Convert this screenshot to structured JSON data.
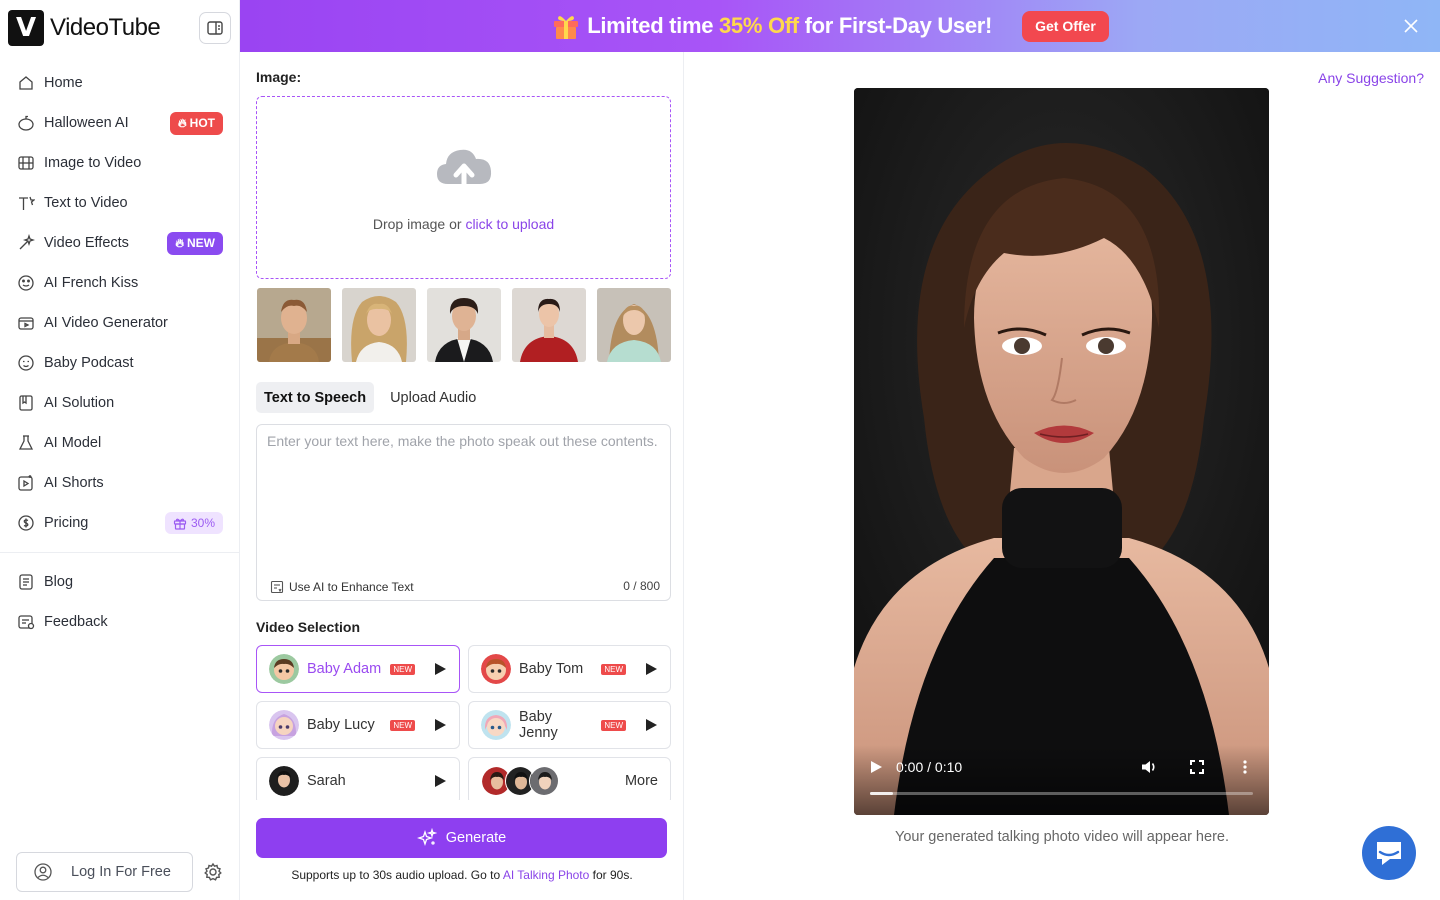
{
  "app": {
    "name": "VideoTube",
    "logo_letter": "V"
  },
  "sidebar": {
    "items": [
      {
        "label": "Home",
        "icon": "home-icon"
      },
      {
        "label": "Halloween AI",
        "icon": "pumpkin-icon",
        "badge": "HOT"
      },
      {
        "label": "Image to Video",
        "icon": "film-icon"
      },
      {
        "label": "Text to Video",
        "icon": "text-icon"
      },
      {
        "label": "Video Effects",
        "icon": "sparkle-icon",
        "badge": "NEW"
      },
      {
        "label": "AI French Kiss",
        "icon": "kiss-icon"
      },
      {
        "label": "AI Video Generator",
        "icon": "video-generator-icon"
      },
      {
        "label": "Baby Podcast",
        "icon": "baby-icon"
      },
      {
        "label": "AI Solution",
        "icon": "book-icon"
      },
      {
        "label": "AI Model",
        "icon": "model-icon"
      },
      {
        "label": "AI Shorts",
        "icon": "shorts-icon"
      },
      {
        "label": "Pricing",
        "icon": "dollar-icon",
        "badge": "30%"
      }
    ],
    "secondary": [
      {
        "label": "Blog",
        "icon": "blog-icon"
      },
      {
        "label": "Feedback",
        "icon": "feedback-icon"
      }
    ],
    "login_label": "Log In For Free"
  },
  "banner": {
    "text_pre": "Limited time ",
    "text_highlight": "35% Off",
    "text_post": " for First-Day User!",
    "button": "Get Offer"
  },
  "form": {
    "image_label": "Image:",
    "drop_text": "Drop image or ",
    "drop_link": "click to upload",
    "tabs": [
      "Text to Speech",
      "Upload Audio"
    ],
    "text_placeholder": "Enter your text here, make the photo speak out these contents.",
    "enhance_label": "Use AI to Enhance Text",
    "counter": "0 / 800",
    "video_selection_label": "Video Selection",
    "voices": [
      {
        "name": "Baby Adam",
        "tag": "NEW",
        "selected": true
      },
      {
        "name": "Baby Tom",
        "tag": "NEW",
        "selected": false
      },
      {
        "name": "Baby Lucy",
        "tag": "NEW",
        "selected": false
      },
      {
        "name": "Baby Jenny",
        "tag": "NEW",
        "selected": false
      },
      {
        "name": "Sarah",
        "tag": "",
        "selected": false
      }
    ],
    "more_label": "More",
    "generate_label": "Generate",
    "support_pre": "Supports up to 30s audio upload. Go to ",
    "support_link": "AI Talking Photo",
    "support_post": " for 90s."
  },
  "preview": {
    "suggestion_link": "Any Suggestion?",
    "time": "0:00 / 0:10",
    "progress": 0.06,
    "caption": "Your generated talking photo video will appear here."
  },
  "colors": {
    "accent": "#8e3ff0",
    "hot": "#ee4b4b",
    "banner_highlight": "#ffd84d",
    "chat": "#2f6fd6"
  }
}
